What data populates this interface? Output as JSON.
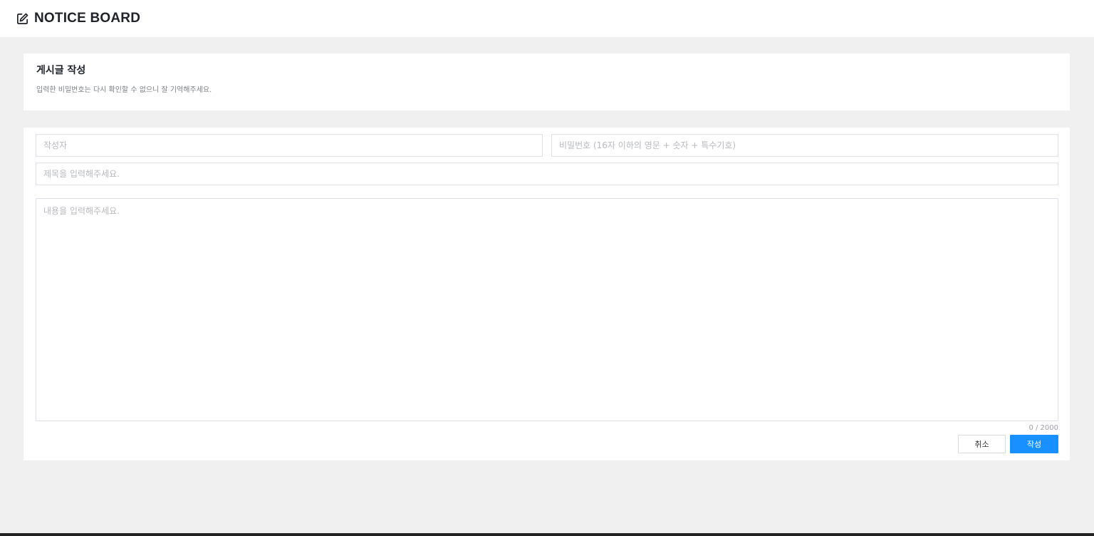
{
  "header": {
    "app_title": "NOTICE BOARD",
    "icon": "edit-icon"
  },
  "intro": {
    "heading": "게시글 작성",
    "subtext": "입력한 비밀번호는 다시 확인할 수 없으니 잘 기억해주세요."
  },
  "form": {
    "author_placeholder": "작성자",
    "password_placeholder": "비밀번호 (16자 이하의 영문 + 숫자 + 특수기호)",
    "title_placeholder": "제목을 입력해주세요.",
    "content_placeholder": "내용을 입력해주세요.",
    "char_counter": "0 / 2000",
    "cancel_label": "취소",
    "submit_label": "작성"
  },
  "colors": {
    "accent": "#1890ff",
    "background": "#f0f0f0",
    "card": "#ffffff"
  }
}
